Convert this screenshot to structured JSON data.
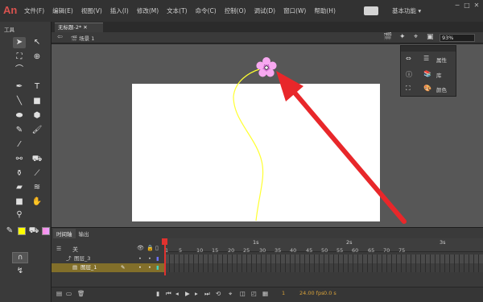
{
  "app": {
    "logo": "An"
  },
  "menubar": {
    "items": [
      "文件(F)",
      "编辑(E)",
      "视图(V)",
      "插入(I)",
      "修改(M)",
      "文本(T)",
      "命令(C)",
      "控制(O)",
      "调试(D)",
      "窗口(W)",
      "帮助(H)"
    ],
    "workspace": "基本功能"
  },
  "tools": {
    "panel_title": "工具"
  },
  "document": {
    "tab_title": "无标题-2*",
    "scene": "场景 1",
    "zoom": "93%"
  },
  "float_panel": {
    "items": [
      "属性",
      "库",
      "颜色"
    ]
  },
  "timeline": {
    "tabs": [
      "时间轴",
      "输出"
    ],
    "layers_header": "关",
    "layers": [
      {
        "name": "图层_3",
        "selected": false
      },
      {
        "name": "图层_1",
        "selected": true
      }
    ],
    "second_marks": [
      "1s",
      "2s",
      "3s"
    ],
    "frame_numbers": [
      "1",
      "5",
      "10",
      "15",
      "20",
      "25",
      "30",
      "35",
      "40",
      "45",
      "50",
      "55",
      "60",
      "65",
      "70",
      "75"
    ],
    "current_frame": "1",
    "fps": "24.00 fps",
    "elapsed": "0.0 s"
  },
  "colors": {
    "stroke": "#ffff00",
    "fill": "#f08ae8",
    "playhead": "#e0322f",
    "arrow": "#e8272a"
  }
}
